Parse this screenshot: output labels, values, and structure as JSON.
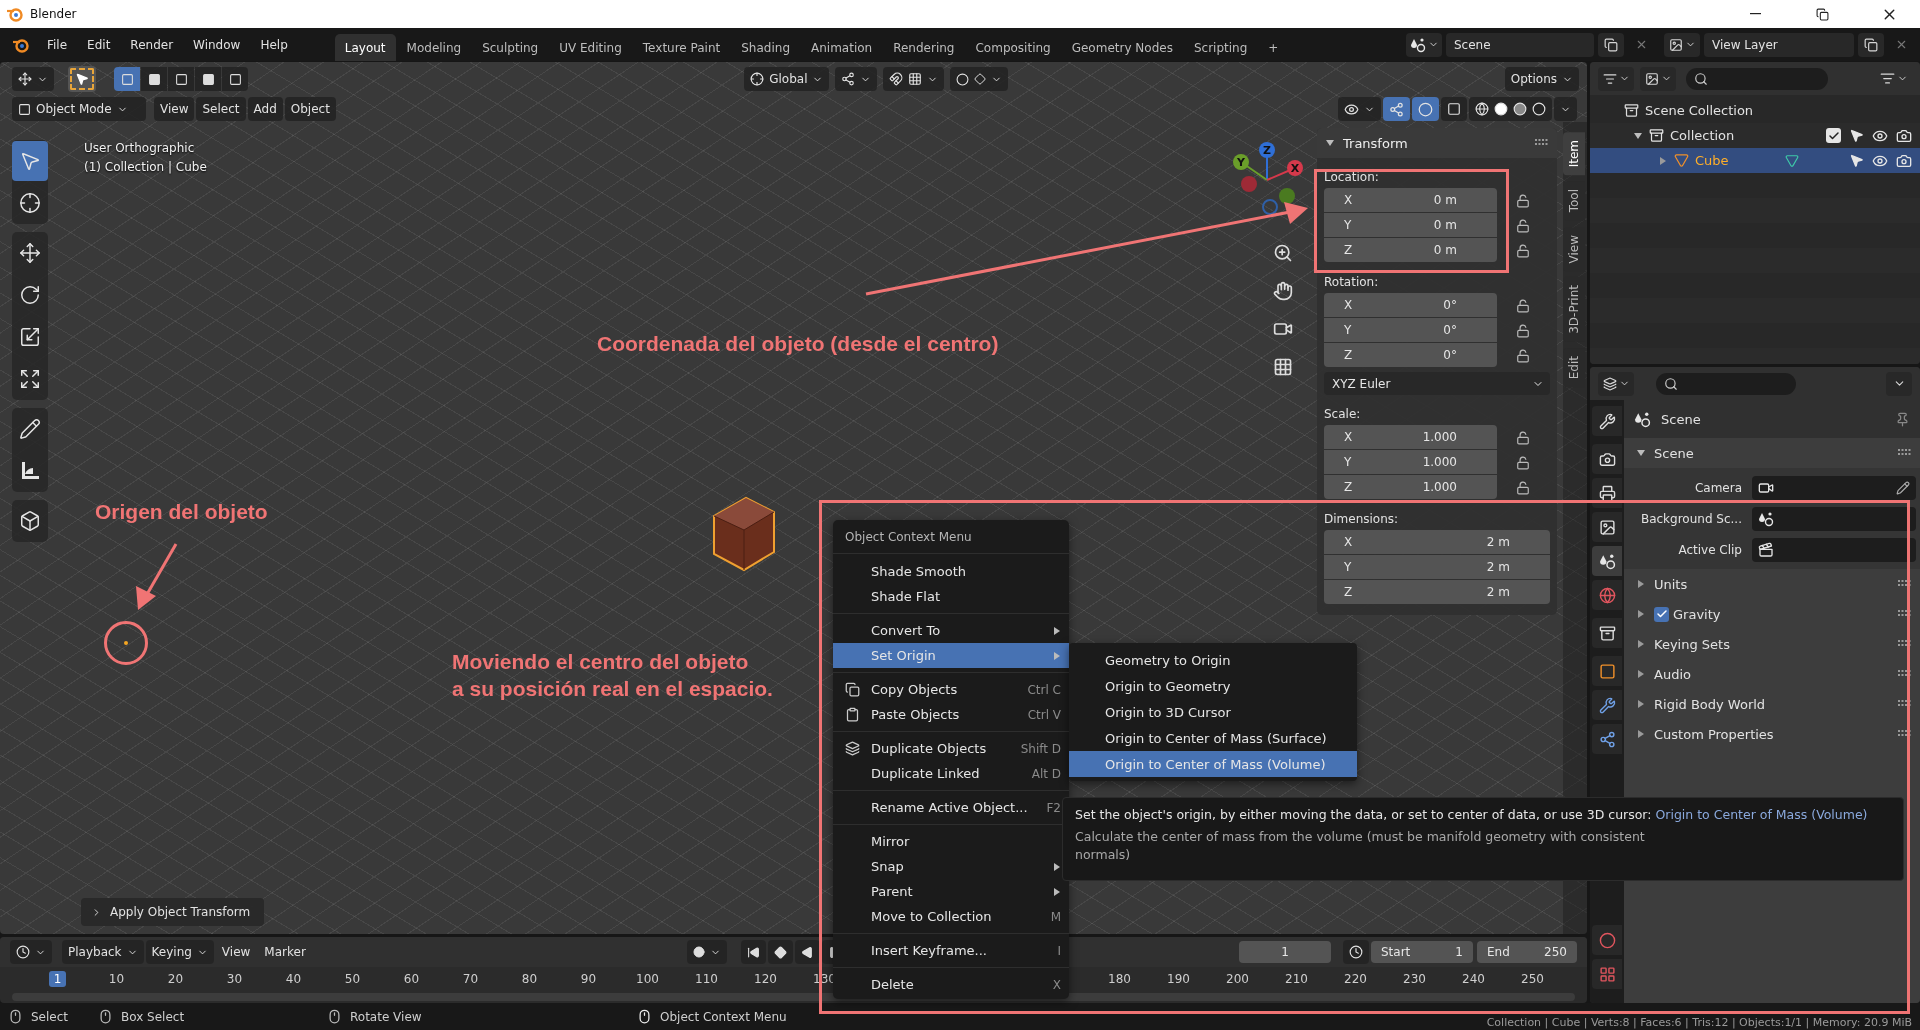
{
  "window": {
    "title": "Blender"
  },
  "menu_bar": [
    "File",
    "Edit",
    "Render",
    "Window",
    "Help"
  ],
  "workspace_tabs": [
    {
      "label": "Layout",
      "selected": true
    },
    {
      "label": "Modeling",
      "selected": false
    },
    {
      "label": "Sculpting",
      "selected": false
    },
    {
      "label": "UV Editing",
      "selected": false
    },
    {
      "label": "Texture Paint",
      "selected": false
    },
    {
      "label": "Shading",
      "selected": false
    },
    {
      "label": "Animation",
      "selected": false
    },
    {
      "label": "Rendering",
      "selected": false
    },
    {
      "label": "Compositing",
      "selected": false
    },
    {
      "label": "Geometry Nodes",
      "selected": false
    },
    {
      "label": "Scripting",
      "selected": false
    }
  ],
  "add_tab": "+",
  "scene": "Scene",
  "view_layer": "View Layer",
  "tool_header": {
    "orientation": "Global",
    "options": "Options"
  },
  "viewport_header": {
    "mode": "Object Mode",
    "menus": [
      "View",
      "Select",
      "Add",
      "Object"
    ]
  },
  "viewport": {
    "view_name": "User Orthographic",
    "collection_info": "(1) Collection | Cube",
    "last_operator": "Apply Object Transform",
    "toolbar": [
      [
        {
          "kind": "select",
          "selected": true
        },
        {
          "kind": "cursor",
          "selected": false
        }
      ],
      [
        {
          "kind": "move",
          "selected": false
        },
        {
          "kind": "rotate",
          "selected": false
        },
        {
          "kind": "scale",
          "selected": false
        },
        {
          "kind": "transform",
          "selected": false
        }
      ],
      [
        {
          "kind": "annotate",
          "selected": false
        },
        {
          "kind": "measure",
          "selected": false
        }
      ],
      [
        {
          "kind": "add_cube",
          "selected": false
        }
      ]
    ],
    "gizmo_axes": [
      {
        "label": "Z",
        "color": "#2f6fd6"
      },
      {
        "label": "Y",
        "color": "#6a9e2a"
      },
      {
        "label": "X",
        "color": "#d6394b"
      }
    ]
  },
  "sidebar": {
    "tabs": [
      {
        "label": "Item",
        "selected": true
      },
      {
        "label": "Tool",
        "selected": false
      },
      {
        "label": "View",
        "selected": false
      },
      {
        "label": "3D-Print",
        "selected": false
      },
      {
        "label": "Edit",
        "selected": false
      }
    ],
    "panel_title": "Transform",
    "groups": [
      {
        "label": "Location:",
        "kind": "lockable",
        "rows": [
          {
            "axis": "X",
            "value": "0 m",
            "locked": false
          },
          {
            "axis": "Y",
            "value": "0 m",
            "locked": false
          },
          {
            "axis": "Z",
            "value": "0 m",
            "locked": false
          }
        ]
      },
      {
        "label": "Rotation:",
        "kind": "lockable",
        "rows": [
          {
            "axis": "X",
            "value": "0°",
            "locked": false
          },
          {
            "axis": "Y",
            "value": "0°",
            "locked": false
          },
          {
            "axis": "Z",
            "value": "0°",
            "locked": false
          }
        ],
        "mode": "XYZ Euler"
      },
      {
        "label": "Scale:",
        "kind": "lockable",
        "rows": [
          {
            "axis": "X",
            "value": "1.000",
            "locked": false
          },
          {
            "axis": "Y",
            "value": "1.000",
            "locked": false
          },
          {
            "axis": "Z",
            "value": "1.000",
            "locked": false
          }
        ]
      },
      {
        "label": "Dimensions:",
        "kind": "plain",
        "rows": [
          {
            "axis": "X",
            "value": "2 m"
          },
          {
            "axis": "Y",
            "value": "2 m"
          },
          {
            "axis": "Z",
            "value": "2 m"
          }
        ]
      }
    ]
  },
  "outliner": {
    "items": [
      {
        "label": "Scene Collection",
        "kind": "scene_collection",
        "selected": false,
        "children": [
          {
            "label": "Collection",
            "kind": "collection",
            "selected": false,
            "expanded": true,
            "checked": true,
            "children": [
              {
                "label": "Cube",
                "kind": "object",
                "selected": true,
                "expanded": false
              }
            ]
          }
        ]
      }
    ]
  },
  "properties": {
    "tabs": [
      [
        {
          "kind": "tool",
          "selected": false
        }
      ],
      [
        {
          "kind": "render",
          "selected": false
        },
        {
          "kind": "output",
          "selected": false
        },
        {
          "kind": "view_layer",
          "selected": false
        },
        {
          "kind": "scene",
          "selected": true
        },
        {
          "kind": "world",
          "selected": false
        }
      ],
      [
        {
          "kind": "collection",
          "selected": false
        }
      ],
      [
        {
          "kind": "object",
          "selected": false
        },
        {
          "kind": "modifiers",
          "selected": false
        },
        {
          "kind": "particles",
          "selected": false
        }
      ],
      [
        {
          "kind": "material",
          "selected": false
        },
        {
          "kind": "texture",
          "selected": false
        }
      ]
    ],
    "context": "Scene",
    "panel": {
      "title": "Scene",
      "expanded": true,
      "fields": [
        {
          "label": "Camera",
          "kind": "camera"
        },
        {
          "label": "Background Sc...",
          "kind": "scene"
        },
        {
          "label": "Active Clip",
          "kind": "clip"
        }
      ]
    },
    "subpanels": [
      {
        "label": "Units",
        "expanded": false
      },
      {
        "label": "Gravity",
        "expanded": false,
        "checked": true
      },
      {
        "label": "Keying Sets",
        "expanded": false
      },
      {
        "label": "Audio",
        "expanded": false
      },
      {
        "label": "Rigid Body World",
        "expanded": false
      },
      {
        "label": "Custom Properties",
        "expanded": false
      }
    ]
  },
  "annotations": {
    "location_note": "Coordenada del objeto (desde el centro)",
    "origin_note": "Origen del objeto",
    "move_note": [
      "Moviendo el centro del objeto",
      "a su posición real en el espacio."
    ]
  },
  "context_menu": {
    "title": "Object Context Menu",
    "sections": [
      [
        {
          "label": "Shade Smooth",
          "selected": false
        },
        {
          "label": "Shade Flat",
          "selected": false
        }
      ],
      [
        {
          "label": "Convert To",
          "selected": false,
          "submenu": true
        },
        {
          "label": "Set Origin",
          "selected": true,
          "submenu": true
        }
      ],
      [
        {
          "label": "Copy Objects",
          "selected": false,
          "shortcut": "Ctrl C"
        },
        {
          "label": "Paste Objects",
          "selected": false,
          "shortcut": "Ctrl V"
        }
      ],
      [
        {
          "label": "Duplicate Objects",
          "selected": false,
          "shortcut": "Shift D"
        },
        {
          "label": "Duplicate Linked",
          "selected": false,
          "shortcut": "Alt D"
        }
      ],
      [
        {
          "label": "Rename Active Object...",
          "selected": false,
          "shortcut": "F2"
        }
      ],
      [
        {
          "label": "Mirror",
          "selected": false
        },
        {
          "label": "Snap",
          "selected": false,
          "submenu": true
        },
        {
          "label": "Parent",
          "selected": false,
          "submenu": true
        },
        {
          "label": "Move to Collection",
          "selected": false,
          "shortcut": "M"
        }
      ],
      [
        {
          "label": "Insert Keyframe...",
          "selected": false,
          "shortcut": "I"
        }
      ],
      [
        {
          "label": "Delete",
          "selected": false,
          "shortcut": "X"
        }
      ]
    ]
  },
  "submenu": {
    "items": [
      {
        "label": "Geometry to Origin",
        "selected": false
      },
      {
        "label": "Origin to Geometry",
        "selected": false
      },
      {
        "label": "Origin to 3D Cursor",
        "selected": false
      },
      {
        "label": "Origin to Center of Mass (Surface)",
        "selected": false
      },
      {
        "label": "Origin to Center of Mass (Volume)",
        "selected": true
      }
    ]
  },
  "tooltip": {
    "text": "Set the object's origin, by either moving the data, or set to center of data, or use 3D cursor:",
    "operator": "Origin to Center of Mass (Volume)",
    "description": "Calculate the center of mass from the volume (must be manifold geometry with consistent normals)"
  },
  "timeline": {
    "menus": [
      "Playback",
      "Keying",
      "View",
      "Marker"
    ],
    "current_frame": "1",
    "start_label": "Start",
    "start": "1",
    "end_label": "End",
    "end": "250",
    "ruler_left": [
      {
        "label": "1",
        "current": true
      },
      {
        "label": "10",
        "current": false
      },
      {
        "label": "20",
        "current": false
      },
      {
        "label": "30",
        "current": false
      },
      {
        "label": "40",
        "current": false
      },
      {
        "label": "50",
        "current": false
      },
      {
        "label": "60",
        "current": false
      },
      {
        "label": "70",
        "current": false
      },
      {
        "label": "80",
        "current": false
      },
      {
        "label": "90",
        "current": false
      },
      {
        "label": "100",
        "current": false
      },
      {
        "label": "110",
        "current": false
      },
      {
        "label": "120",
        "current": false
      },
      {
        "label": "130",
        "current": false
      }
    ],
    "ruler_right": [
      {
        "label": "180",
        "current": false
      },
      {
        "label": "190",
        "current": false
      },
      {
        "label": "200",
        "current": false
      },
      {
        "label": "210",
        "current": false
      },
      {
        "label": "220",
        "current": false
      },
      {
        "label": "230",
        "current": false
      },
      {
        "label": "240",
        "current": false
      },
      {
        "label": "250",
        "current": false
      }
    ]
  },
  "status_bar": {
    "items": [
      {
        "label": "Select",
        "kind": "left_click"
      },
      {
        "label": "Box Select",
        "kind": "drag"
      },
      {
        "label": "Rotate View",
        "kind": "middle"
      },
      {
        "label": "Object Context Menu",
        "kind": "right_click"
      }
    ],
    "stats": "Collection | Cube | Verts:8 | Faces:6 | Tris:12 | Objects:1/1 | Memory: 20.9 MiB"
  }
}
